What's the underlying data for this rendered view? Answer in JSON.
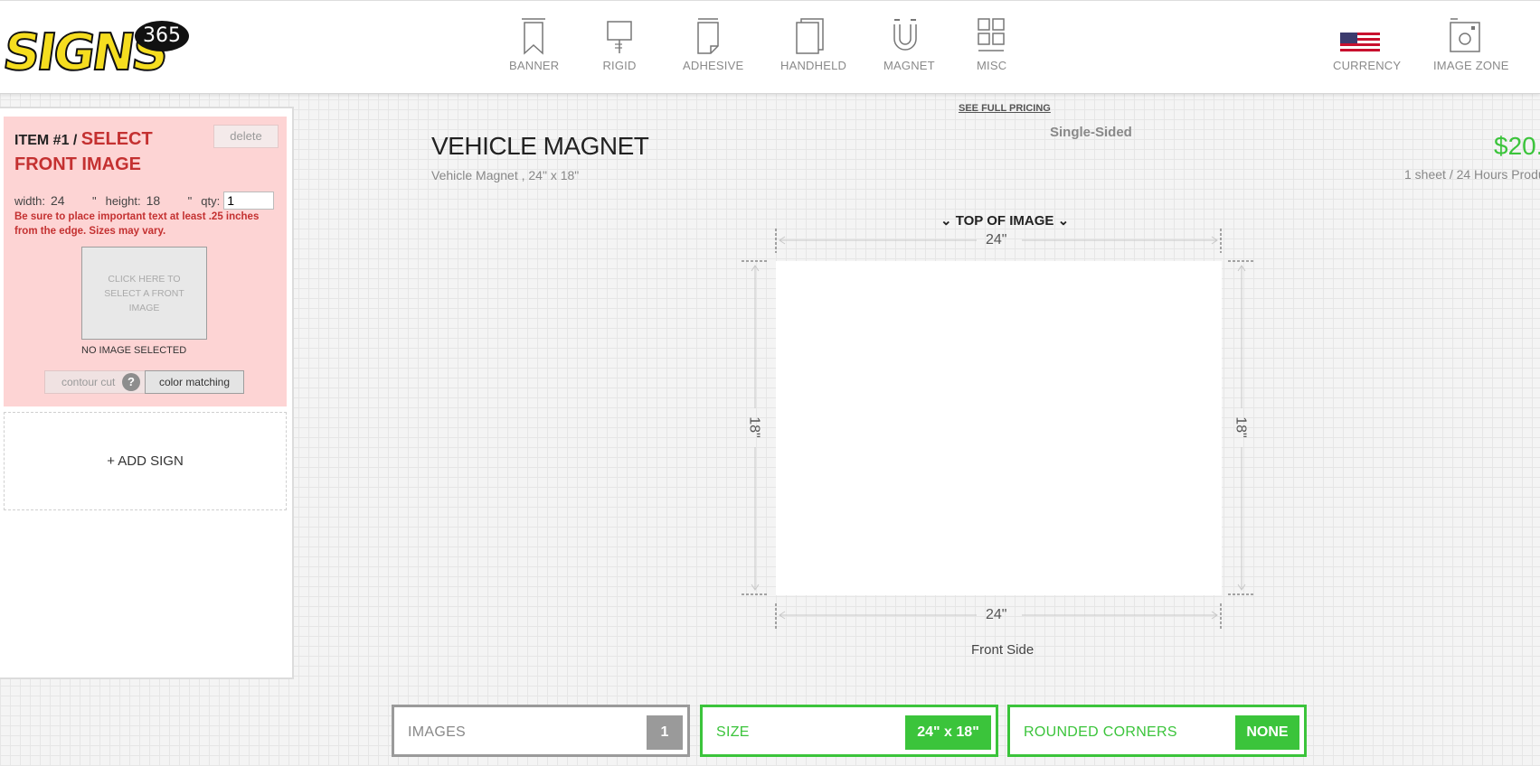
{
  "brand": {
    "logo_text": "SIGNS",
    "logo_badge": "365"
  },
  "nav": {
    "items": [
      {
        "label": "BANNER",
        "icon": "banner-icon"
      },
      {
        "label": "RIGID",
        "icon": "rigid-icon"
      },
      {
        "label": "ADHESIVE",
        "icon": "adhesive-icon"
      },
      {
        "label": "HANDHELD",
        "icon": "handheld-icon"
      },
      {
        "label": "MAGNET",
        "icon": "magnet-icon"
      },
      {
        "label": "MISC",
        "icon": "misc-icon"
      }
    ],
    "right": [
      {
        "label": "CURRENCY",
        "icon": "us-flag-icon"
      },
      {
        "label": "IMAGE ZONE",
        "icon": "image-zone-icon"
      }
    ]
  },
  "item": {
    "number": "ITEM #1 / ",
    "select_label": "SELECT FRONT IMAGE",
    "delete_label": "delete",
    "width_label": "width:",
    "width_value": "24",
    "height_label": "height:",
    "height_value": "18",
    "unit": "\"",
    "qty_label": "qty:",
    "qty_value": "1",
    "warning": "Be sure to place important text at least .25 inches from the edge. Sizes may vary.",
    "image_prompt": "CLICK HERE TO SELECT A FRONT IMAGE",
    "no_image": "NO IMAGE SELECTED",
    "contour_label": "contour cut",
    "help": "?",
    "color_matching_label": "color matching"
  },
  "add_sign_label": "+ ADD SIGN",
  "product": {
    "see_pricing": "SEE FULL PRICING",
    "sides": "Single-Sided",
    "title": "VEHICLE MAGNET",
    "subtitle": "Vehicle Magnet , 24\" x 18\"",
    "price": "$20.",
    "production": "1 sheet / 24 Hours Produc"
  },
  "canvas": {
    "top_label": "TOP OF IMAGE",
    "width_dim": "24\"",
    "height_dim": "18\"",
    "side_label": "Front Side"
  },
  "options": {
    "images": {
      "label": "IMAGES",
      "value": "1"
    },
    "size": {
      "label": "SIZE",
      "value": "24\" x 18\""
    },
    "corners": {
      "label": "ROUNDED CORNERS",
      "value": "NONE"
    }
  },
  "colors": {
    "accent_green": "#3bc43b",
    "alert_red": "#c43131",
    "card_pink": "#fdd4d4",
    "logo_yellow": "#f5dd1f"
  }
}
